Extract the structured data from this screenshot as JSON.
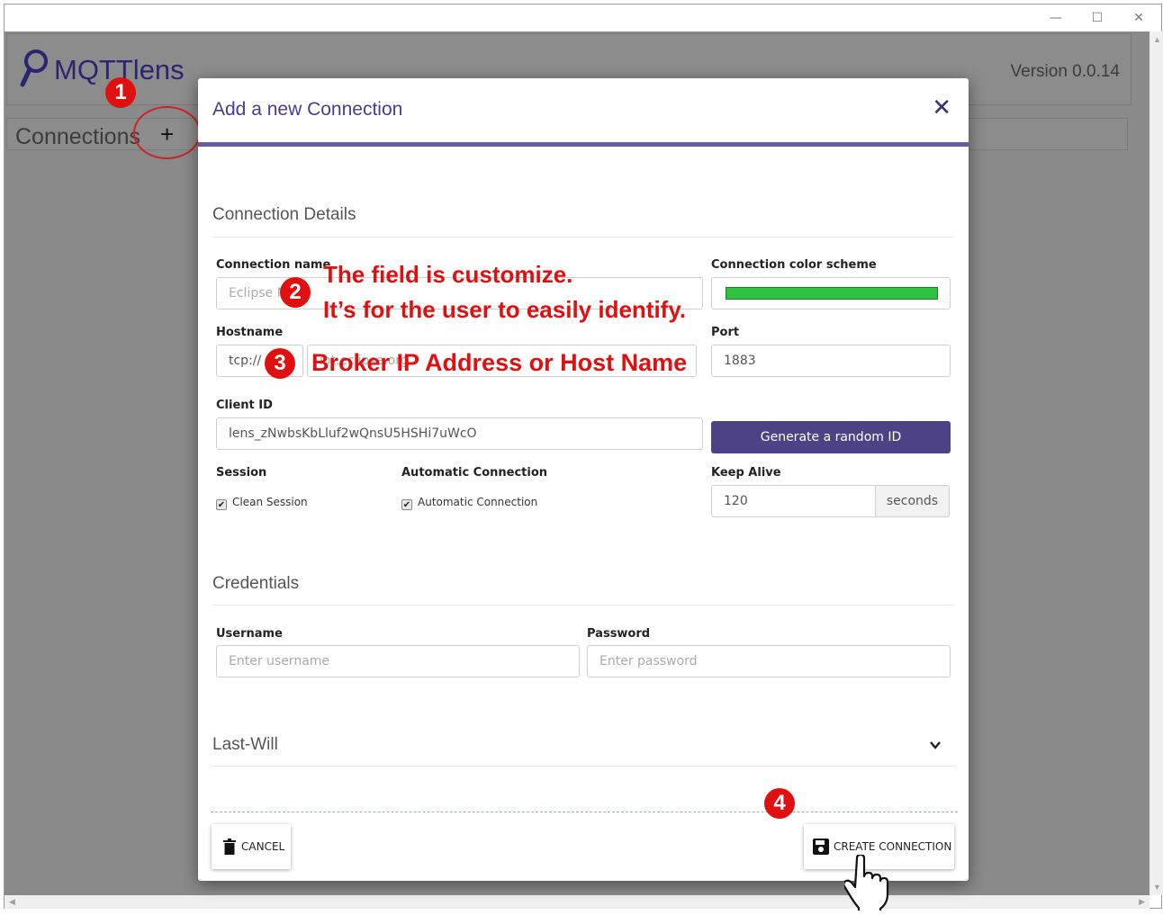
{
  "window": {
    "minimize_glyph": "—",
    "maximize_glyph": "☐",
    "close_glyph": "✕"
  },
  "app": {
    "name": "MQTTlens",
    "version": "Version 0.0.14"
  },
  "connections": {
    "label": "Connections",
    "add_glyph": "+"
  },
  "modal": {
    "title": "Add a new Connection",
    "close_glyph": "✕",
    "details_section": "Connection Details",
    "connection_name": {
      "label": "Connection name",
      "placeholder": "Eclipse M"
    },
    "color_scheme": {
      "label": "Connection color scheme",
      "color": "#2fc23e"
    },
    "hostname": {
      "label": "Hostname",
      "protocol": "tcp://",
      "placeholder": "iot.eclipse.org"
    },
    "port": {
      "label": "Port",
      "value": "1883"
    },
    "client_id": {
      "label": "Client ID",
      "value": "lens_zNwbsKbLluf2wQnsU5HSHi7uWcO",
      "generate_label": "Generate a random ID"
    },
    "session": {
      "label": "Session",
      "checkbox_label": "Clean Session",
      "checked": true
    },
    "auto_connection": {
      "label": "Automatic Connection",
      "checkbox_label": "Automatic Connection",
      "checked": true
    },
    "keep_alive": {
      "label": "Keep Alive",
      "value": "120",
      "unit": "seconds"
    },
    "credentials_section": "Credentials",
    "username": {
      "label": "Username",
      "placeholder": "Enter username"
    },
    "password": {
      "label": "Password",
      "placeholder": "Enter password"
    },
    "last_will_section": "Last-Will",
    "cancel_label": "CANCEL",
    "create_label": "CREATE CONNECTION"
  },
  "annotations": {
    "badge1": "1",
    "badge2": "2",
    "badge3": "3",
    "badge4": "4",
    "note2_line1": "The field is customize.",
    "note2_line2": "It’s for the user to easily identify.",
    "note3": "Broker IP Address or Host Name",
    "accent": "#e01010"
  }
}
